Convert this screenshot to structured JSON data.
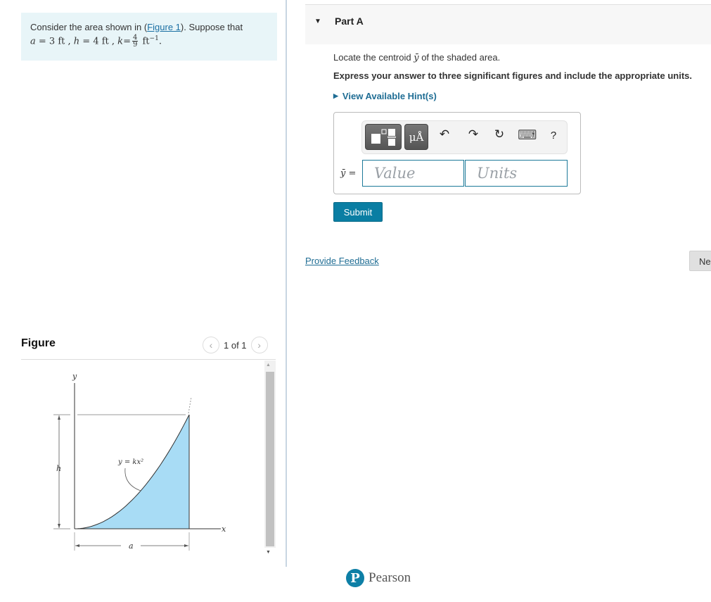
{
  "problem": {
    "intro": "Consider the area shown in (",
    "figure_link": "Figure 1",
    "intro_end": "). Suppose that",
    "a_var": "a",
    "a_value": "= 3 ft ,",
    "h_var": "h",
    "h_value": "= 4 ft ,",
    "k_var": "k",
    "k_eq": "=",
    "k_num": "4",
    "k_den": "9",
    "k_unit": "ft",
    "k_exp": "−1",
    "period": "."
  },
  "figure": {
    "title": "Figure",
    "pager_text": "1 of 1",
    "prev_icon": "‹",
    "next_icon": "›",
    "labels": {
      "y_axis": "y",
      "x_axis": "x",
      "h": "h",
      "a": "a",
      "curve": "y = kx²"
    },
    "fill_color": "#a8dcf5"
  },
  "part": {
    "title": "Part A",
    "instruction": "Locate the centroid",
    "instruction_var": "ȳ",
    "instruction_end": "of the shaded area.",
    "express": "Express your answer to three significant figures and include the appropriate units.",
    "hint_label": "View Available Hint(s)",
    "answer": {
      "label": "ȳ =",
      "value_placeholder": "Value",
      "units_placeholder": "Units",
      "value": "",
      "units": ""
    },
    "toolbar": {
      "templates_icon": "fraction-template-icon",
      "units_label": "μÅ",
      "undo": "↶",
      "redo": "↷",
      "reset": "↻",
      "keyboard": "⌨",
      "help": "?"
    },
    "submit_label": "Submit"
  },
  "footer": {
    "feedback_label": "Provide Feedback",
    "next_label": "Next",
    "brand": "Pearson",
    "brand_initial": "P"
  },
  "colors": {
    "accent": "#0a7ea3",
    "link": "#1f6d94",
    "problem_bg": "#e8f5f8"
  }
}
